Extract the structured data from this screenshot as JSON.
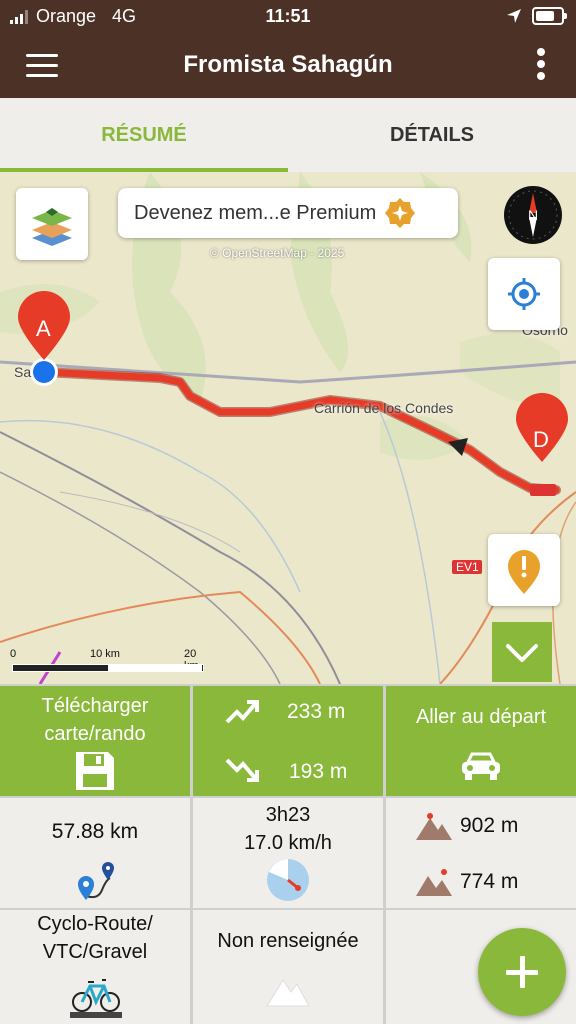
{
  "status": {
    "carrier": "Orange",
    "network": "4G",
    "time": "11:51"
  },
  "appbar": {
    "title": "Fromista Sahagún",
    "menu_icon": "hamburger-menu-icon",
    "more_icon": "more-vertical-icon"
  },
  "tabs": [
    {
      "label": "RÉSUMÉ",
      "active": true
    },
    {
      "label": "DÉTAILS",
      "active": false
    }
  ],
  "map": {
    "premium_text": "Devenez mem...e Premium",
    "attribution": "© OpenStreetMap - 2025",
    "compass_letter": "N",
    "start_marker": "A",
    "end_marker": "D",
    "labels": {
      "town_left": "Sa",
      "town_mid": "Carrión de los Condes",
      "town_right": "Osorno",
      "road": "EV1"
    },
    "scale": {
      "zero": "0",
      "mid": "10 km",
      "end": "20 km"
    },
    "route_color": "#e63b26"
  },
  "actions": {
    "download_label_1": "Télécharger",
    "download_label_2": "carte/rando",
    "ascent": "233 m",
    "descent": "193 m",
    "go_start_label": "Aller au départ"
  },
  "stats": {
    "distance": "57.88 km",
    "duration": "3h23",
    "speed": "17.0 km/h",
    "max_alt": "902 m",
    "min_alt": "774 m",
    "activity_1": "Cyclo-Route/",
    "activity_2": "VTC/Gravel",
    "difficulty": "Non renseignée"
  },
  "colors": {
    "brand": "#4b3126",
    "accent": "#8ab83b"
  }
}
